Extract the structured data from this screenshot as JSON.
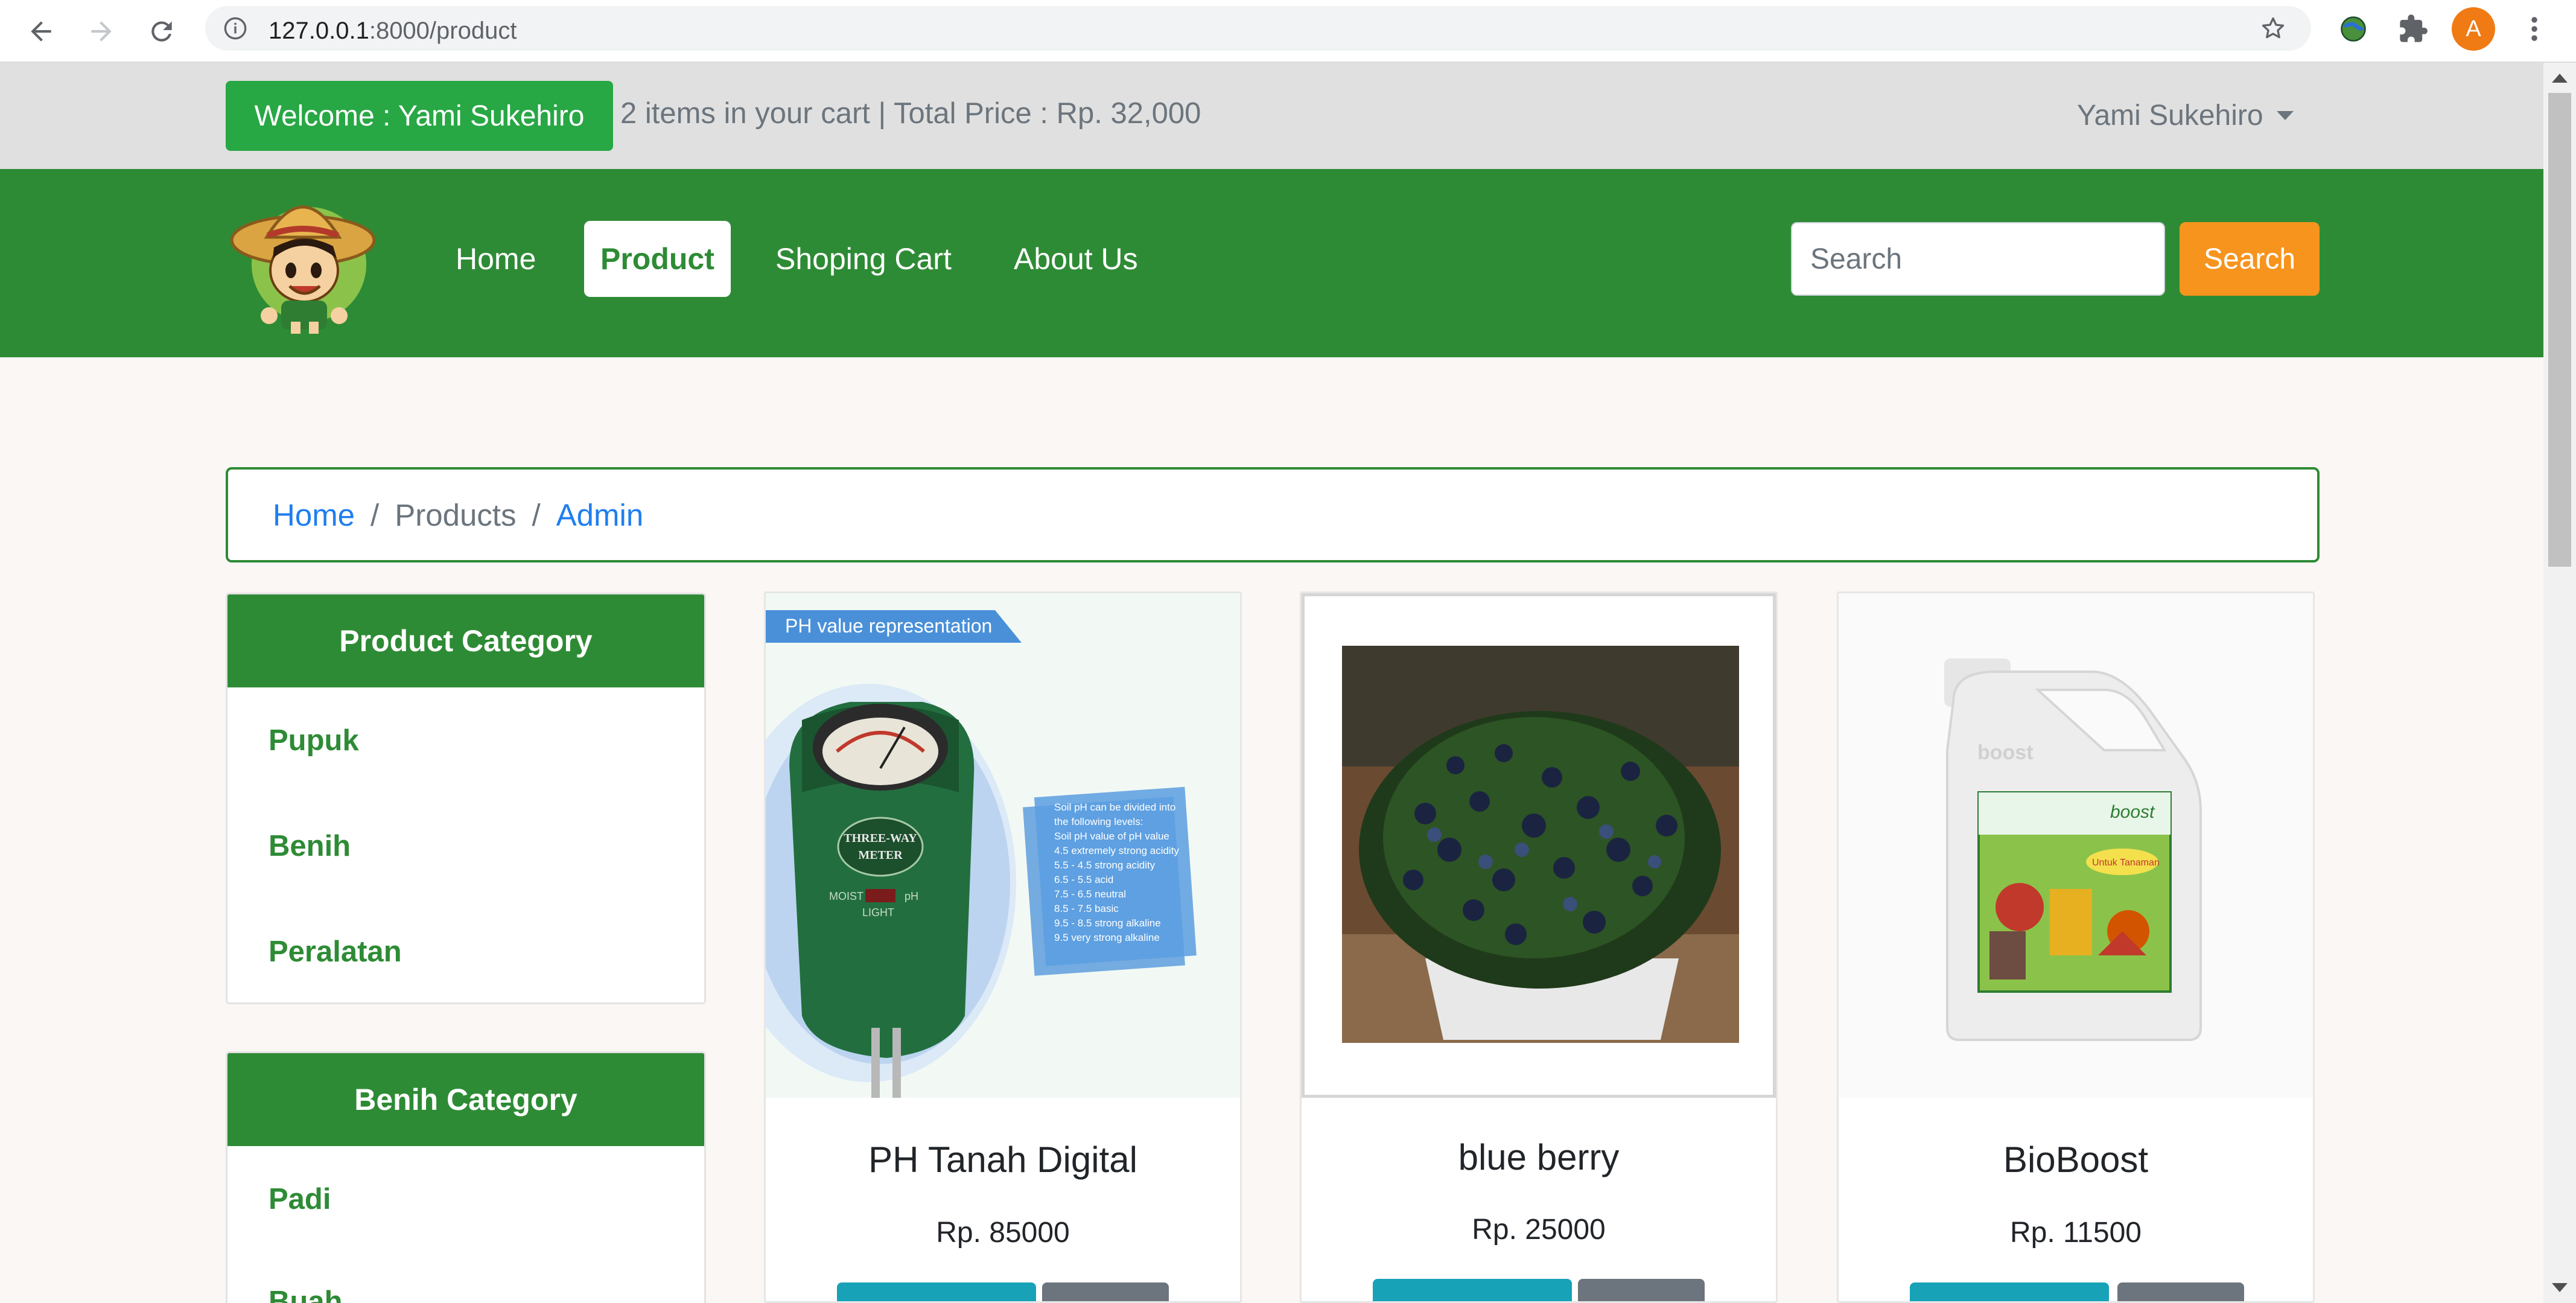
{
  "browser": {
    "url_host": "127.0.0.1",
    "url_path": ":8000/product",
    "profile_initial": "A"
  },
  "topbar": {
    "welcome": "Welcome : Yami Sukehiro",
    "cart_info": "2 items in your cart | Total Price : Rp. 32,000",
    "user_name": "Yami Sukehiro"
  },
  "nav": {
    "items": [
      {
        "label": "Home"
      },
      {
        "label": "Product"
      },
      {
        "label": "Shoping Cart"
      },
      {
        "label": "About Us"
      }
    ],
    "search_placeholder": "Search",
    "search_button": "Search"
  },
  "breadcrumb": {
    "home": "Home",
    "products": "Products",
    "admin": "Admin"
  },
  "sidebar": {
    "product_category": {
      "title": "Product Category",
      "items": [
        "Pupuk",
        "Benih",
        "Peralatan"
      ]
    },
    "benih_category": {
      "title": "Benih Category",
      "items": [
        "Padi",
        "Buah"
      ]
    }
  },
  "products": [
    {
      "name": "PH Tanah Digital",
      "price": "Rp. 85000",
      "image_banner": "PH value representation",
      "meter_label": "THREE-WAY METER",
      "meter_moist": "MOIST",
      "meter_ph": "pH",
      "meter_light": "LIGHT",
      "ph_table": [
        "Soil pH can be divided into",
        "the following levels:",
        "Soil pH value of pH value",
        "4.5 extremely strong acidity",
        "5.5 - 4.5 strong acidity",
        "6.5 - 5.5 acid",
        "7.5 - 6.5 neutral",
        "8.5 - 7.5 basic",
        "9.5 - 8.5 strong alkaline",
        "9.5 very strong alkaline"
      ]
    },
    {
      "name": "blue berry",
      "price": "Rp. 25000"
    },
    {
      "name": "BioBoost",
      "price": "Rp. 11500",
      "label_brand": "boost",
      "label_tag": "Untuk Tanaman"
    }
  ],
  "colors": {
    "brand_green": "#2e8b35",
    "welcome_green": "#28a745",
    "search_orange": "#f7941d",
    "link_blue": "#1e7ef0",
    "detail_teal": "#17a2b8",
    "cart_gray": "#6c757d"
  }
}
